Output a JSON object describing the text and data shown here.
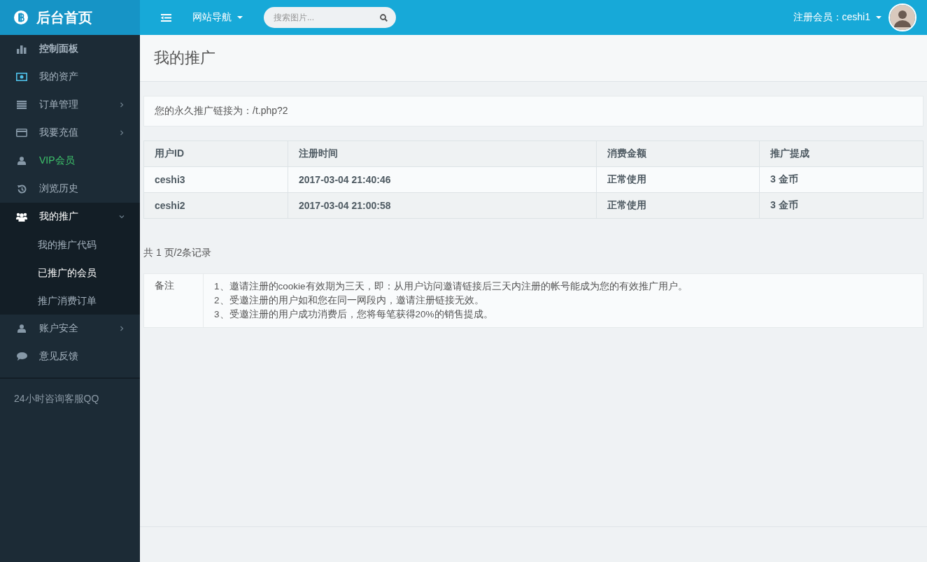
{
  "brand": {
    "title": "后台首页"
  },
  "topbar": {
    "nav_menu": "网站导航",
    "search": {
      "placeholder": "搜索图片..."
    },
    "user_label": "注册会员：ceshi1"
  },
  "sidebar": {
    "items": [
      {
        "label": "控制面板",
        "kind": "heading",
        "expandable": false,
        "expanded": false
      },
      {
        "label": "我的资产",
        "kind": "link",
        "expandable": false,
        "expanded": false
      },
      {
        "label": "订单管理",
        "kind": "link",
        "expandable": true,
        "expanded": false
      },
      {
        "label": "我要充值",
        "kind": "link",
        "expandable": true,
        "expanded": false
      },
      {
        "label": "VIP会员",
        "kind": "vip",
        "expandable": false,
        "expanded": false
      },
      {
        "label": "浏览历史",
        "kind": "link",
        "expandable": false,
        "expanded": false
      },
      {
        "label": "我的推广",
        "kind": "link",
        "expandable": true,
        "expanded": true,
        "children": [
          {
            "label": "我的推广代码",
            "selected": false
          },
          {
            "label": "已推广的会员",
            "selected": true
          },
          {
            "label": "推广消费订单",
            "selected": false
          }
        ]
      },
      {
        "label": "账户安全",
        "kind": "link",
        "expandable": true,
        "expanded": false
      },
      {
        "label": "意见反馈",
        "kind": "link",
        "expandable": false,
        "expanded": false
      }
    ],
    "footer": "24小时咨询客服QQ"
  },
  "page": {
    "title": "我的推广",
    "link_notice": "您的永久推广链接为：/t.php?2"
  },
  "table": {
    "columns": [
      "用户ID",
      "注册时间",
      "消费金额",
      "推广提成"
    ],
    "rows": [
      [
        "ceshi3",
        "2017-03-04 21:40:46",
        "正常使用",
        "3 金币"
      ],
      [
        "ceshi2",
        "2017-03-04 21:00:58",
        "正常使用",
        "3 金币"
      ]
    ]
  },
  "pagination": "共 1 页/2条记录",
  "notes": {
    "label": "备注",
    "lines": [
      "1、邀请注册的cookie有效期为三天，即：从用户访问邀请链接后三天内注册的帐号能成为您的有效推广用户。",
      "2、受邀注册的用户如和您在同一网段内，邀请注册链接无效。",
      "3、受邀注册的用户成功消费后，您将每笔获得20%的销售提成。"
    ]
  }
}
